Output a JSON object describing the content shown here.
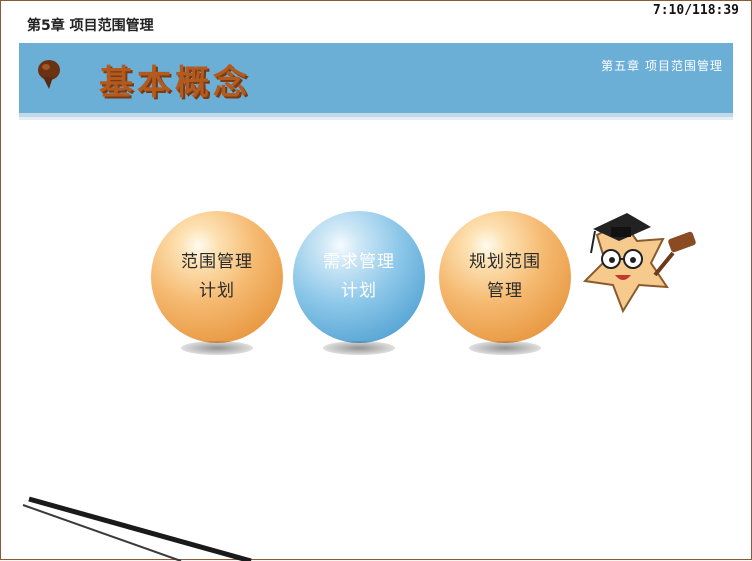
{
  "top_title": "第5章 项目范围管理",
  "clock": "7:10/118:39",
  "header": {
    "title": "基本概念",
    "chapter": "第五章 项目范围管理"
  },
  "balls": [
    {
      "label": "范围管理\n计划",
      "color": "orange"
    },
    {
      "label": "需求管理\n计划",
      "color": "blue"
    },
    {
      "label": "规划范围\n管理",
      "color": "orange"
    }
  ],
  "colors": {
    "header_bar": "#6baed6",
    "title_text": "#b35a1f",
    "ball_orange": "#f5b970",
    "ball_blue": "#8ec8e9"
  },
  "icons": [
    "pin-icon",
    "mascot-star-icon"
  ]
}
